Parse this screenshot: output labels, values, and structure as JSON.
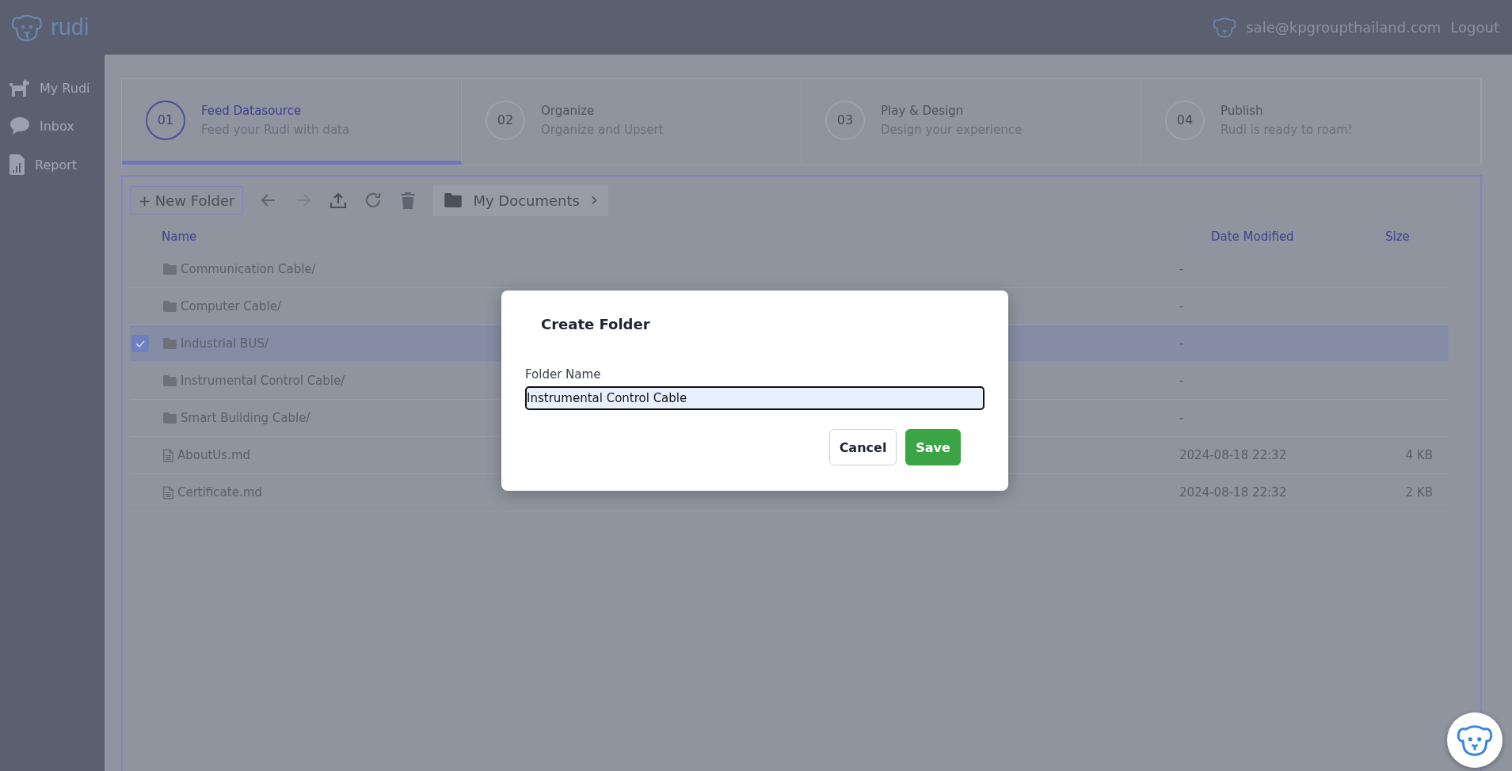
{
  "header": {
    "logo_text": "rudi",
    "user_email": "sale@kpgroupthailand.com",
    "logout": "Logout"
  },
  "sidebar": {
    "items": [
      {
        "label": "My Rudi",
        "kind": "dog"
      },
      {
        "label": "Inbox",
        "kind": "chat"
      },
      {
        "label": "Report",
        "kind": "report"
      }
    ]
  },
  "steps": [
    {
      "number": "01",
      "title": "Feed Datasource",
      "subtitle": "Feed your Rudi with data",
      "selected": true
    },
    {
      "number": "02",
      "title": "Organize",
      "subtitle": "Organize and Upsert",
      "selected": false
    },
    {
      "number": "03",
      "title": "Play & Design",
      "subtitle": "Design your experience",
      "selected": false
    },
    {
      "number": "04",
      "title": "Publish",
      "subtitle": "Rudi is ready to roam!",
      "selected": false
    }
  ],
  "toolbar": {
    "new_folder": "+ New Folder",
    "breadcrumb": "My Documents"
  },
  "table": {
    "columns": [
      "Name",
      "Date Modified",
      "Size"
    ],
    "rows": [
      {
        "kind": "folder",
        "name": "Communication Cable/",
        "date": "-",
        "selected": false
      },
      {
        "kind": "folder",
        "name": "Computer Cable/",
        "date": "-",
        "selected": false
      },
      {
        "kind": "folder",
        "name": "Industrial BUS/",
        "date": "-",
        "selected": true
      },
      {
        "kind": "folder",
        "name": "Instrumental Control Cable/",
        "date": "-",
        "selected": false
      },
      {
        "kind": "folder",
        "name": "Smart Building Cable/",
        "date": "-",
        "selected": false
      },
      {
        "kind": "file",
        "name": "AboutUs.md",
        "date": "2024-08-18 22:32",
        "size": "4 KB",
        "selected": false
      },
      {
        "kind": "file",
        "name": "Certificate.md",
        "date": "2024-08-18 22:32",
        "size": "2 KB",
        "selected": false
      }
    ]
  },
  "dialog": {
    "title": "Create Folder",
    "field_label": "Folder Name",
    "field_value": "Instrumental Control Cable",
    "cancel": "Cancel",
    "save": "Save"
  }
}
